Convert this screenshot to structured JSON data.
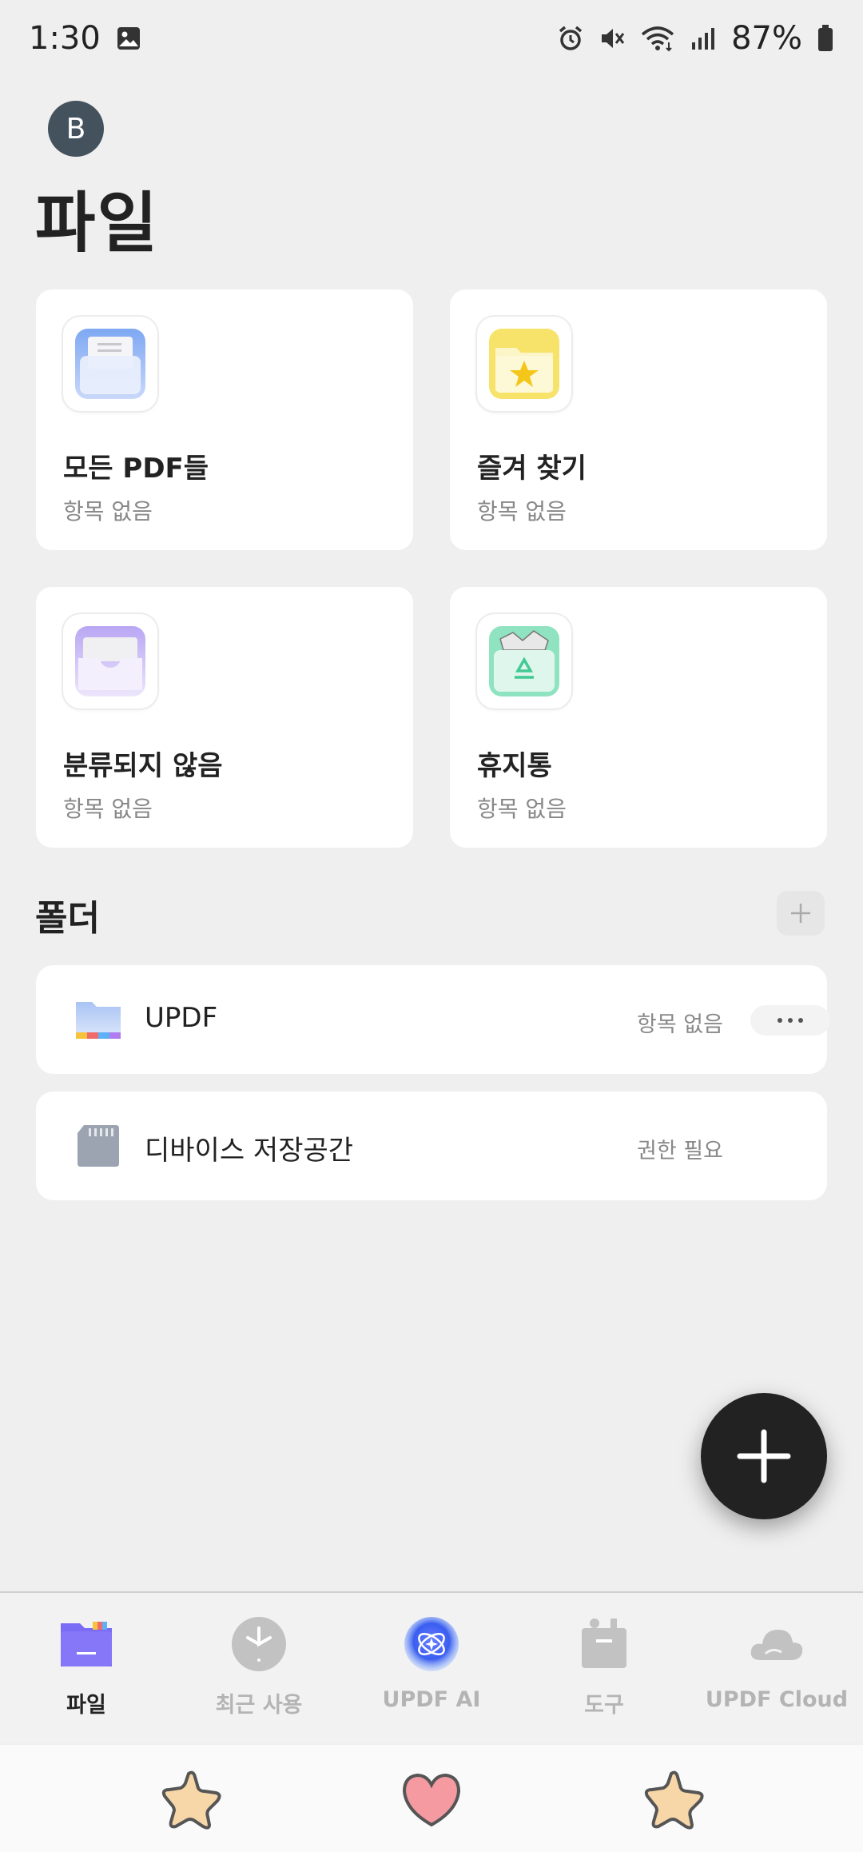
{
  "status_bar": {
    "time": "1:30",
    "battery_pct": "87%"
  },
  "header": {
    "avatar_letter": "B",
    "title": "파일"
  },
  "cards": [
    {
      "title": "모든 PDF들",
      "sub": "항목 없음",
      "icon": "documents-folder-icon"
    },
    {
      "title": "즐겨 찾기",
      "sub": "항목 없음",
      "icon": "star-folder-icon"
    },
    {
      "title": "분류되지 않음",
      "sub": "항목 없음",
      "icon": "inbox-tray-icon"
    },
    {
      "title": "휴지통",
      "sub": "항목 없음",
      "icon": "recycle-bin-icon"
    }
  ],
  "folders": {
    "section_title": "폴더",
    "items": [
      {
        "name": "UPDF",
        "status": "항목 없음",
        "icon": "folder-icon"
      },
      {
        "name": "디바이스 저장공간",
        "status": "권한 필요",
        "icon": "sd-card-icon"
      }
    ]
  },
  "nav": {
    "items": [
      {
        "label": "파일",
        "icon": "files-folder-icon",
        "active": true
      },
      {
        "label": "최근 사용",
        "icon": "clock-icon",
        "active": false
      },
      {
        "label": "UPDF AI",
        "icon": "ai-orb-icon",
        "active": false
      },
      {
        "label": "도구",
        "icon": "toolbox-icon",
        "active": false
      },
      {
        "label": "UPDF Cloud",
        "icon": "cloud-icon",
        "active": false
      }
    ]
  },
  "colors": {
    "background": "#efefef",
    "card": "#ffffff",
    "accent_purple": "#7b6cf6",
    "fab": "#222222"
  }
}
